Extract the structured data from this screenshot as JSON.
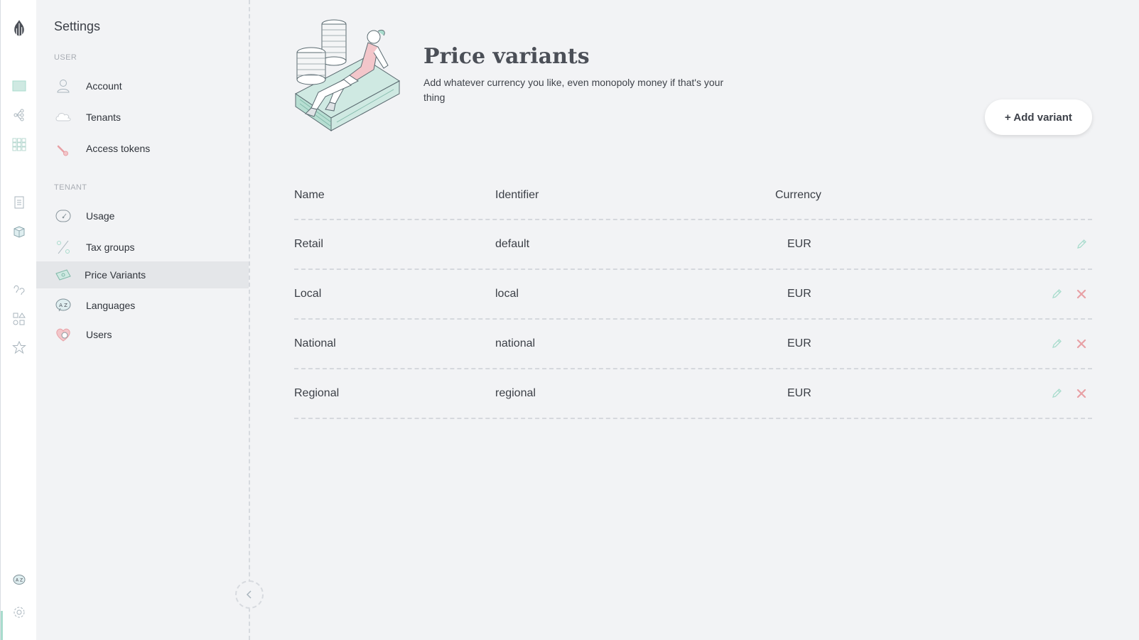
{
  "sidebar": {
    "title": "Settings",
    "sections": [
      {
        "label": "USER"
      },
      {
        "label": "TENANT"
      }
    ],
    "items": [
      {
        "label": "Account",
        "icon": "user-icon"
      },
      {
        "label": "Tenants",
        "icon": "cloud-icon"
      },
      {
        "label": "Access tokens",
        "icon": "key-icon"
      },
      {
        "label": "Usage",
        "icon": "gauge-icon"
      },
      {
        "label": "Tax groups",
        "icon": "percent-icon"
      },
      {
        "label": "Price Variants",
        "icon": "banknote-icon",
        "active": true
      },
      {
        "label": "Languages",
        "icon": "language-icon"
      },
      {
        "label": "Users",
        "icon": "heart-users-icon"
      }
    ]
  },
  "rail": {
    "icons": [
      "logo-icon",
      "catalogue-icon",
      "tree-icon",
      "grid-icon",
      "orders-icon",
      "box-icon",
      "customers-icon",
      "shapes-icon",
      "star-icon",
      "language-icon",
      "settings-icon"
    ],
    "active": "settings-icon"
  },
  "header": {
    "title": "Price variants",
    "subtitle": "Add whatever currency you like, even monopoly money if that's your thing",
    "add_button": "+ Add variant"
  },
  "table": {
    "columns": [
      "Name",
      "Identifier",
      "Currency"
    ],
    "rows": [
      {
        "name": "Retail",
        "identifier": "default",
        "currency": "EUR",
        "deletable": false
      },
      {
        "name": "Local",
        "identifier": "local",
        "currency": "EUR",
        "deletable": true
      },
      {
        "name": "National",
        "identifier": "national",
        "currency": "EUR",
        "deletable": true
      },
      {
        "name": "Regional",
        "identifier": "regional",
        "currency": "EUR",
        "deletable": true
      }
    ]
  },
  "colors": {
    "accent": "#a9dccd",
    "delete": "#e8a0a5",
    "background": "#f2f3f5",
    "rail": "#ffffff"
  }
}
